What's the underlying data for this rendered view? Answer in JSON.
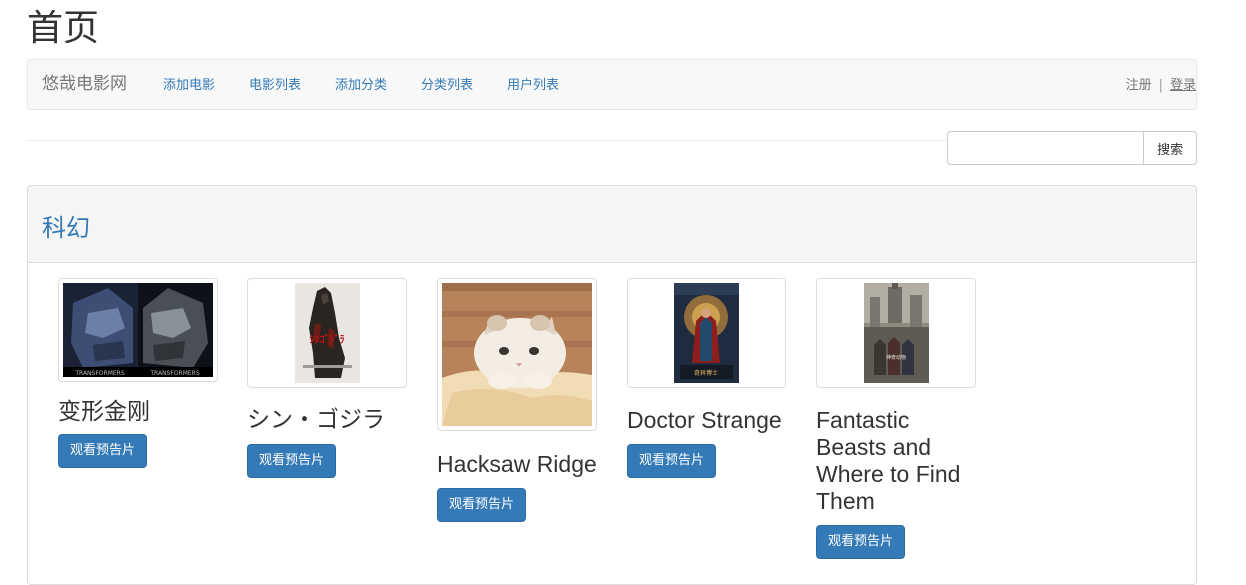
{
  "page": {
    "title": "首页"
  },
  "navbar": {
    "brand": "悠哉电影网",
    "links": [
      "添加电影",
      "电影列表",
      "添加分类",
      "分类列表",
      "用户列表"
    ],
    "register": "注册",
    "separator": "|",
    "login": "登录"
  },
  "search": {
    "placeholder": "",
    "value": "",
    "button": "搜索"
  },
  "category": {
    "title": "科幻",
    "movies": [
      {
        "name": "变形金刚",
        "button": "观看预告片",
        "poster_icon": "transformers-poster"
      },
      {
        "name": "シン・ゴジラ",
        "button": "观看预告片",
        "poster_icon": "godzilla-poster"
      },
      {
        "name": "Hacksaw Ridge",
        "button": "观看预告片",
        "poster_icon": "cat-photo"
      },
      {
        "name": "Doctor Strange",
        "button": "观看预告片",
        "poster_icon": "doctor-strange-poster"
      },
      {
        "name": "Fantastic Beasts and Where to Find Them",
        "button": "观看预告片",
        "poster_icon": "fantastic-beasts-poster"
      }
    ]
  },
  "colors": {
    "link": "#337ab7",
    "button": "#337ab7",
    "navbar_bg": "#f8f8f8"
  }
}
